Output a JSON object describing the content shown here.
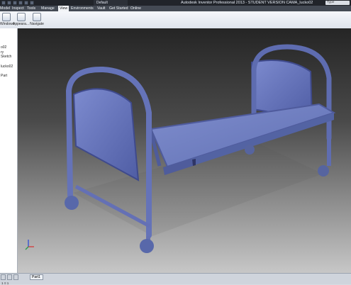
{
  "app": {
    "window_title": "Autodesk Inventor Professional 2013 - STUDENT VERSION  CAMA_lucko02",
    "style_dropdown": "Default",
    "help_search": "Type"
  },
  "menu": {
    "items": [
      "Model",
      "Inspect",
      "Tools",
      "Manage",
      "View",
      "Environments",
      "Vault",
      "Get Started",
      "Online"
    ]
  },
  "ribbon": {
    "buttons": [
      {
        "label": "Windows",
        "icon": "windows-icon"
      },
      {
        "label": "Appeara...",
        "icon": "appearance-icon"
      },
      {
        "label": "Navigate",
        "icon": "navigate-icon"
      }
    ]
  },
  "browser": {
    "items": [
      "o02",
      "ry",
      "Sketch",
      "",
      "lucko02",
      "",
      "Part"
    ]
  },
  "bottom": {
    "doc_tab": "Part1",
    "status": "1 ≡ 1"
  },
  "colors": {
    "title_bg": "#21242a",
    "menu_bg": "#444a54",
    "active_tab": "#f1f3f6",
    "viewport_top": "#252525",
    "viewport_bottom": "#c7c7c7",
    "bed_blue": "#6876b9"
  }
}
